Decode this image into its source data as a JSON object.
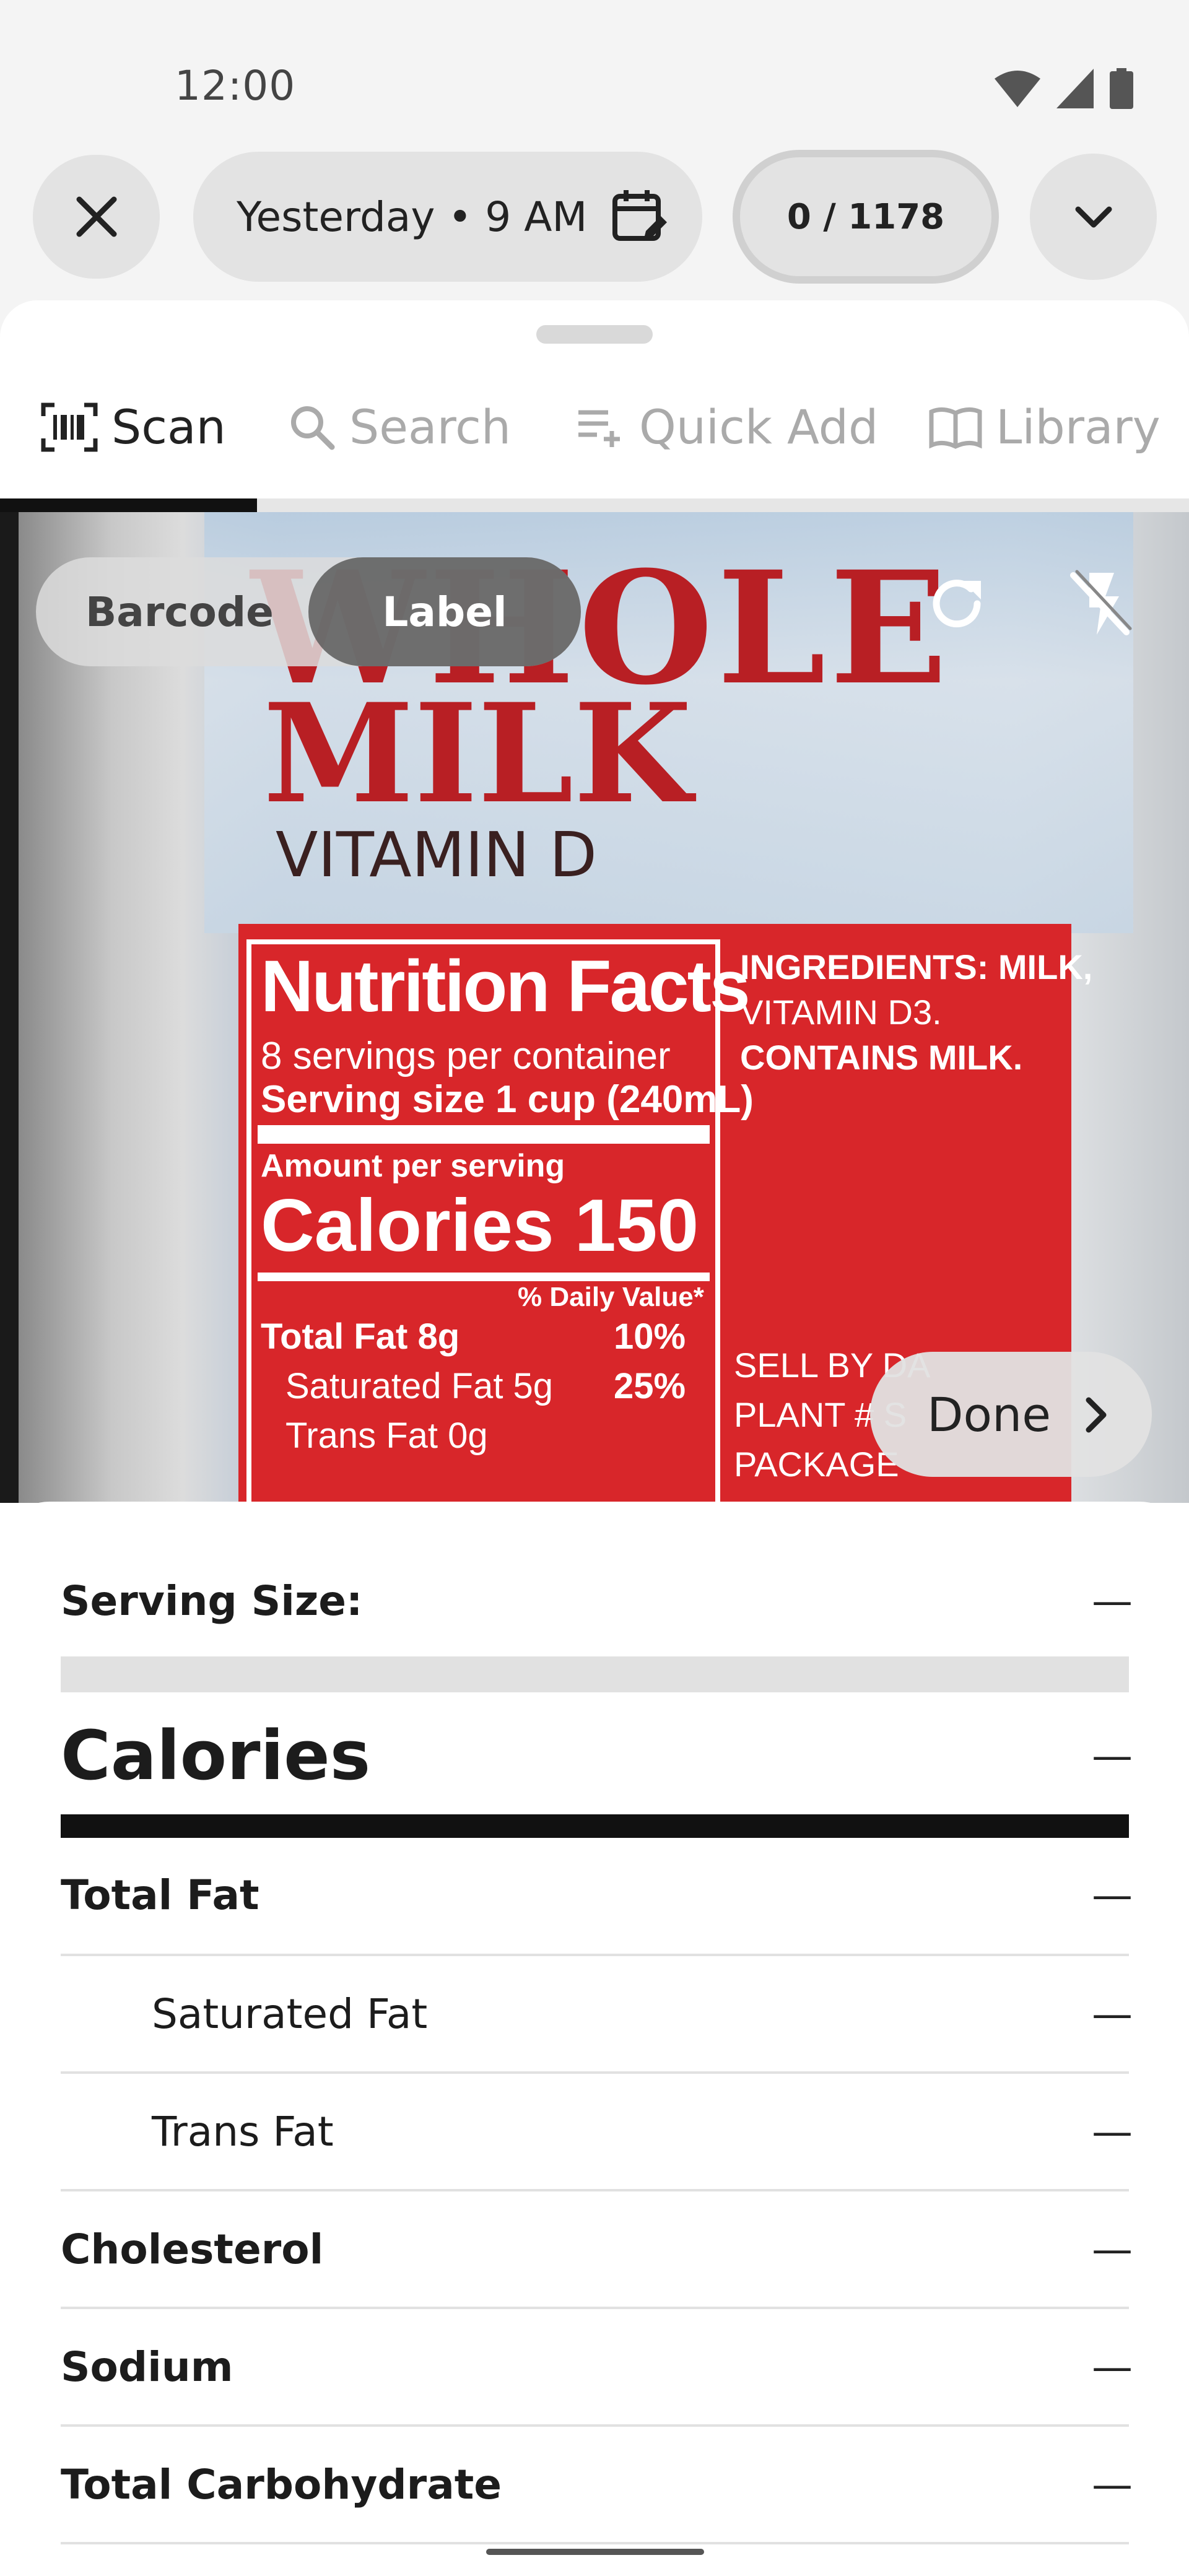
{
  "status_bar": {
    "time": "12:00",
    "icons": [
      "wifi-icon",
      "signal-icon",
      "battery-icon"
    ]
  },
  "top_bar": {
    "close_icon": "close-icon",
    "date_label": "Yesterday • 9 AM",
    "date_icon": "calendar-edit-icon",
    "counter_label": "0 / 1178",
    "expand_icon": "chevron-down-icon"
  },
  "tabs": [
    {
      "label": "Scan",
      "icon": "barcode-scan-icon",
      "active": true
    },
    {
      "label": "Search",
      "icon": "search-icon",
      "active": false
    },
    {
      "label": "Quick Add",
      "icon": "playlist-add-icon",
      "active": false
    },
    {
      "label": "Library",
      "icon": "book-icon",
      "active": false
    }
  ],
  "camera": {
    "mode_options": [
      "Barcode",
      "Label"
    ],
    "selected_mode": "Label",
    "refresh_icon": "refresh-icon",
    "flash_icon": "flash-off-icon",
    "done_label": "Done",
    "product_text": {
      "line1": "WHOLE",
      "line2": "MILK",
      "line3": "VITAMIN D",
      "nf_title": "Nutrition Facts",
      "nf_servings": "8 servings per container",
      "nf_serving_size": "Serving size    1 cup (240mL)",
      "nf_amount": "Amount per serving",
      "nf_calories": "Calories      150",
      "nf_dv": "% Daily Value*",
      "nf_total_fat": "Total Fat 8g",
      "nf_total_fat_pct": "10%",
      "nf_sat_fat": "Saturated Fat 5g",
      "nf_sat_fat_pct": "25%",
      "nf_trans_fat": "Trans Fat 0g",
      "ingredients_1": "INGREDIENTS: MILK,",
      "ingredients_2": "VITAMIN D3.",
      "ingredients_3": "CONTAINS MILK.",
      "sell_1": "SELL BY DA",
      "sell_2": "PLANT # S",
      "sell_3": "PACKAGE"
    }
  },
  "nutrition_panel": {
    "serving_size": {
      "label": "Serving Size:",
      "value": "—"
    },
    "calories": {
      "label": "Calories",
      "value": "—"
    },
    "rows": [
      {
        "label": "Total Fat",
        "value": "—"
      },
      {
        "label": "Saturated Fat",
        "value": "—"
      },
      {
        "label": "Trans Fat",
        "value": "—"
      },
      {
        "label": "Cholesterol",
        "value": "—"
      },
      {
        "label": "Sodium",
        "value": "—"
      },
      {
        "label": "Total Carbohydrate",
        "value": "—"
      }
    ]
  },
  "colors": {
    "accent_dark": "#111111",
    "muted": "#aaaaaa",
    "surface": "#ffffff",
    "chip": "#e3e3e3"
  }
}
